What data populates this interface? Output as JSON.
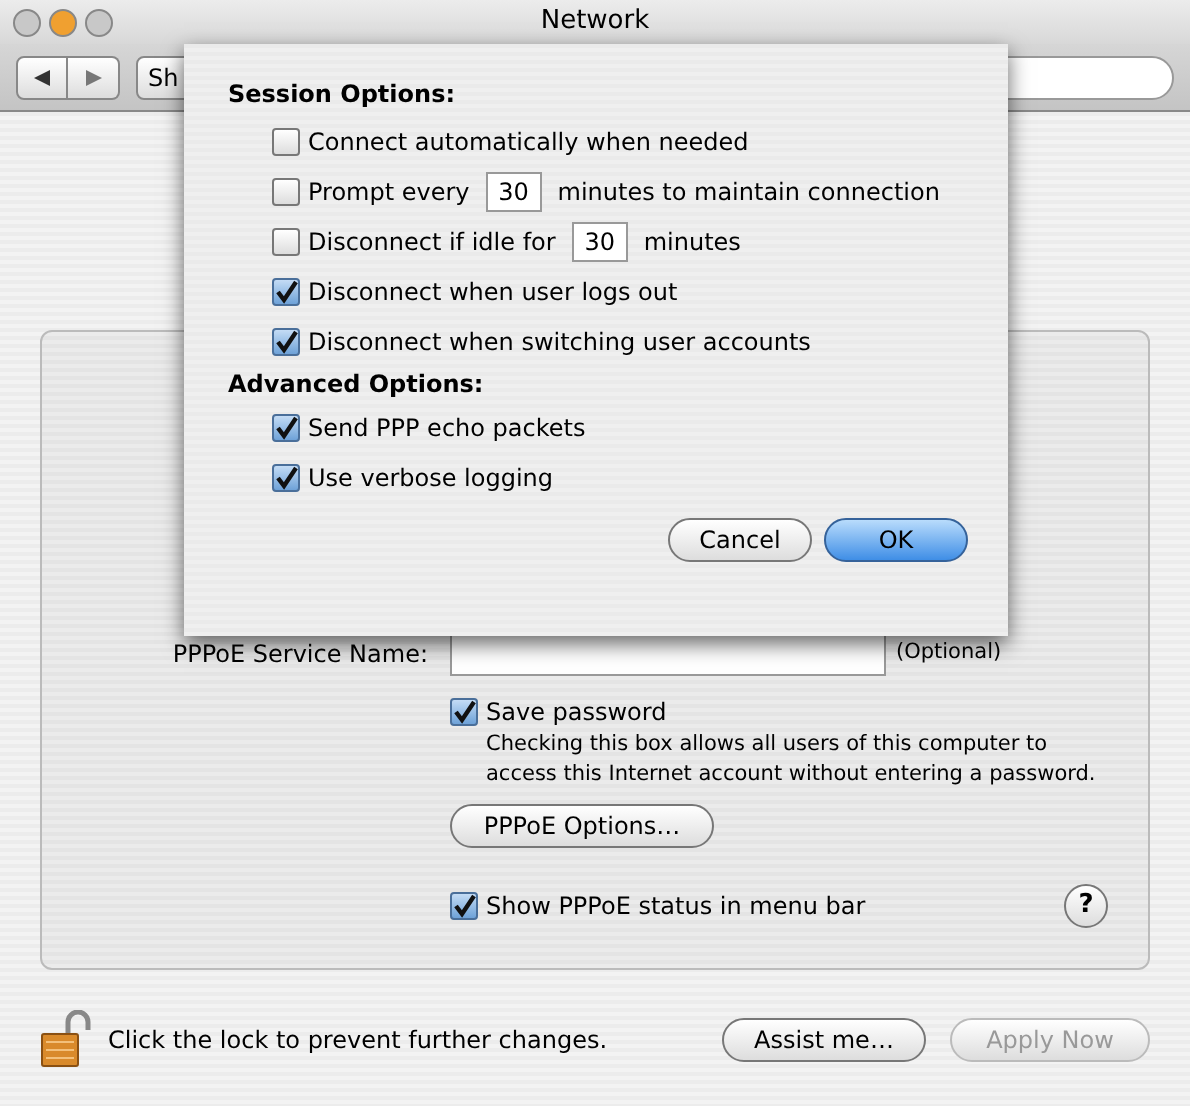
{
  "window": {
    "title": "Network"
  },
  "toolbar": {
    "show_all": "Sh"
  },
  "pppoe": {
    "fields": [
      {
        "label": "PPPoE Service Name:",
        "note": "(Optional)"
      }
    ],
    "save_password": {
      "label": "Save password",
      "checked": true,
      "description": "Checking this box allows all users of this computer to access this Internet account without entering a password."
    },
    "options_button": "PPPoE Options…",
    "show_status": {
      "label": "Show PPPoE status in menu bar",
      "checked": true
    },
    "help": "?"
  },
  "footer": {
    "lock_text": "Click the lock to prevent further changes.",
    "buttons": [
      {
        "label": "Assist me…",
        "disabled": false
      },
      {
        "label": "Apply Now",
        "disabled": true
      }
    ]
  },
  "sheet": {
    "sections": [
      {
        "title": "Session Options:",
        "options": [
          {
            "kind": "check",
            "label": "Connect automatically when needed",
            "checked": false
          },
          {
            "kind": "interval",
            "before": "Prompt every",
            "value": "30",
            "after": "minutes to maintain connection",
            "checked": false
          },
          {
            "kind": "interval",
            "before": "Disconnect if idle for",
            "value": "30",
            "after": "minutes",
            "checked": false
          },
          {
            "kind": "check",
            "label": "Disconnect when user logs out",
            "checked": true
          },
          {
            "kind": "check",
            "label": "Disconnect when switching user accounts",
            "checked": true
          }
        ]
      },
      {
        "title": "Advanced Options:",
        "options": [
          {
            "kind": "check",
            "label": "Send PPP echo packets",
            "checked": true
          },
          {
            "kind": "check",
            "label": "Use verbose logging",
            "checked": true
          }
        ]
      }
    ],
    "buttons": [
      {
        "label": "Cancel",
        "default": false
      },
      {
        "label": "OK",
        "default": true
      }
    ]
  }
}
